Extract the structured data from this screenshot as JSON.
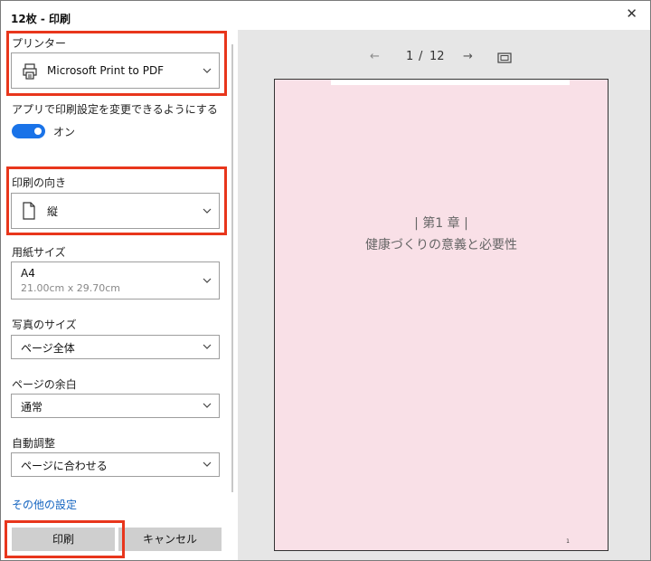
{
  "window": {
    "title": "12枚 - 印刷",
    "close_icon": "close-icon"
  },
  "printer": {
    "label": "プリンター",
    "value": "Microsoft Print to PDF",
    "icon": "printer-icon"
  },
  "app_settings": {
    "label": "アプリで印刷設定を変更できるようにする",
    "toggle_state": "オン",
    "toggle_on": true
  },
  "orientation": {
    "label": "印刷の向き",
    "value": "縦",
    "icon": "page-icon"
  },
  "paper_size": {
    "label": "用紙サイズ",
    "value": "A4",
    "sub": "21.00cm x 29.70cm"
  },
  "photo_size": {
    "label": "写真のサイズ",
    "value": "ページ全体"
  },
  "margins": {
    "label": "ページの余白",
    "value": "通常"
  },
  "auto_fit": {
    "label": "自動調整",
    "value": "ページに合わせる"
  },
  "more_settings": "その他の設定",
  "buttons": {
    "print": "印刷",
    "cancel": "キャンセル"
  },
  "preview": {
    "current_page": "1",
    "separator": "/",
    "total_pages": "12",
    "chapter": "| 第1 章 |",
    "heading": "健康づくりの意義と必要性",
    "page_number": "1",
    "page_color": "#f9e0e7"
  },
  "colors": {
    "accent": "#1a73e8",
    "highlight": "#e8361c",
    "link": "#1565c0"
  }
}
